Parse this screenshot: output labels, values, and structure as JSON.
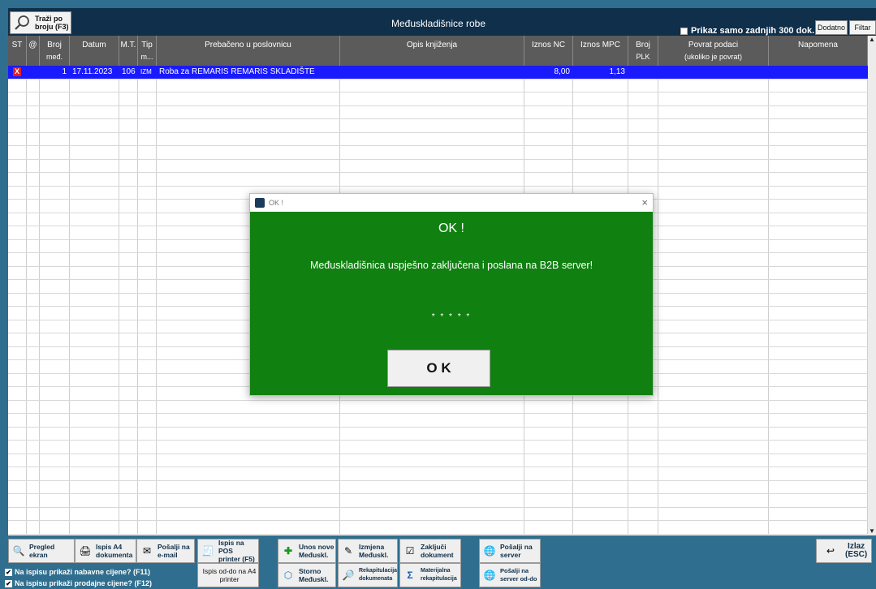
{
  "toolbar_top": {
    "search_label": "Traži po\nbroju (F3)",
    "window_title": "Međuskladišnice robe",
    "last300_label": "Prikaz samo zadnjih 300 dok.",
    "dodatno": "Dodatno",
    "filter": "Filtar"
  },
  "columns": [
    {
      "h1": "ST",
      "h2": ""
    },
    {
      "h1": "@",
      "h2": ""
    },
    {
      "h1": "Broj",
      "h2": "međ."
    },
    {
      "h1": "Datum",
      "h2": ""
    },
    {
      "h1": "M.T.",
      "h2": ""
    },
    {
      "h1": "Tip",
      "h2": "m..."
    },
    {
      "h1": "Prebačeno u poslovnicu",
      "h2": ""
    },
    {
      "h1": "Opis knjiženja",
      "h2": ""
    },
    {
      "h1": "Iznos NC",
      "h2": ""
    },
    {
      "h1": "Iznos MPC",
      "h2": ""
    },
    {
      "h1": "Broj",
      "h2": "PLK"
    },
    {
      "h1": "Povrat podaci",
      "h2": "(ukoliko je povrat)"
    },
    {
      "h1": "Napomena",
      "h2": ""
    }
  ],
  "rows": [
    {
      "st": "X",
      "at": "",
      "broj": "1",
      "datum": "17.11.2023",
      "mt": "106",
      "tip": "IZM",
      "prebaceno": "Roba za REMARIS REMARIS SKLADIŠTE",
      "opis": "",
      "iznos_nc": "8,00",
      "iznos_mpc": "1,13",
      "plk": "",
      "povrat": "",
      "napomena": ""
    }
  ],
  "bottom": {
    "pregled": "Pregled\nekran",
    "ispis_a4": "Ispis A4\ndokumenta",
    "posalji_email": "Pošalji na\ne-mail",
    "ispis_pos": "Ispis na POS\nprinter (F5)",
    "unos_nove": "Unos nove\nMeđuskl.",
    "izmjena": "Izmjena\nMeđuskl.",
    "zakljuci": "Zaključi\ndokument",
    "posalji_server": "Pošalji na\nserver",
    "ispis_od_do": "Ispis od-do na A4\nprinter",
    "storno": "Storno\nMeđuskl.",
    "rekapitulacija": "Rekapitulacija\ndokumenata",
    "materijalna": "Materijalna\nrekapitulacija",
    "posalji_server_od_do": "Pošalji na\nserver od-do",
    "izlaz": "Izlaz\n(ESC)",
    "cb_nabavne": "Na ispisu prikaži nabavne cijene? (F11)",
    "cb_prodajne": "Na ispisu prikaži prodajne cijene? (F12)"
  },
  "dialog": {
    "title": "OK !",
    "heading": "OK !",
    "message": "Međuskladišnica uspješno zaključena i poslana na B2B server!",
    "stars": "* * * * *",
    "button": "O K"
  },
  "colors": {
    "dialog_bg": "#108010",
    "selected_row": "#1a1aff",
    "header_bg": "#5b5b5b",
    "frame": "#2f6e8e"
  }
}
